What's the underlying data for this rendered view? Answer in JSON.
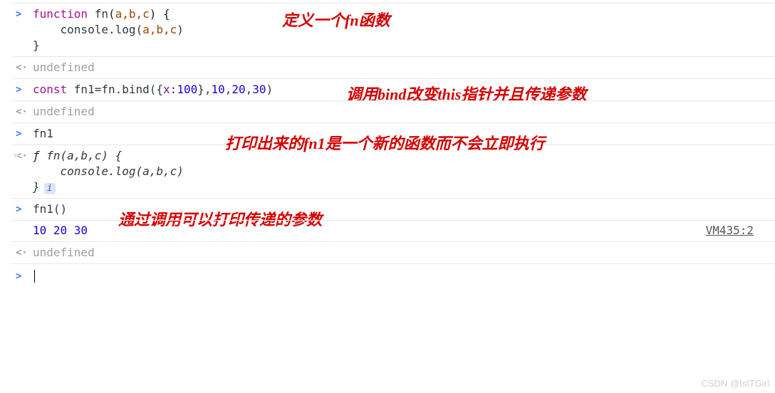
{
  "markers": {
    "in": ">",
    "out": "<·"
  },
  "code": {
    "fn_def_l1_kw": "function ",
    "fn_def_l1_name": "fn",
    "fn_def_l1_open": "(",
    "fn_def_l1_args": "a,b,c",
    "fn_def_l1_close": ") {",
    "fn_def_l2": "    console.log(",
    "fn_def_l2_args": "a,b,c",
    "fn_def_l2_end": ")",
    "fn_def_l3": "}",
    "undef": "undefined",
    "bind_l_const": "const ",
    "bind_l_lhs": "fn1=fn.bind({",
    "bind_l_prop": "x",
    "bind_l_colon": ":",
    "bind_l_v1": "100",
    "bind_l_mid": "},",
    "bind_l_a1": "10",
    "bind_l_c": ",",
    "bind_l_a2": "20",
    "bind_l_a3": "30",
    "bind_l_end": ")",
    "ref": "fn1",
    "dump_l1_f": "ƒ ",
    "dump_l1_rest": "fn(a,b,c) {",
    "dump_l2": "    console.log(a,b,c)",
    "dump_l3": "}",
    "info": "i",
    "call": "fn1()",
    "out_vals": "10 20 30",
    "vmlink": "VM435:2"
  },
  "annotations": {
    "a1_pre": "定义一个",
    "a1_mid": "fn",
    "a1_post": "函数",
    "a2_pre": "调用",
    "a2_b1": "bind",
    "a2_mid": "改变",
    "a2_b2": "this",
    "a2_post": "指针并且传递参数",
    "a3_pre": "打印出来的",
    "a3_mid": "fn1",
    "a3_post": "是一个新的函数而不会立即执行",
    "a4": "通过调用可以打印传递的参数"
  },
  "watermark": "CSDN @IsITGirl"
}
